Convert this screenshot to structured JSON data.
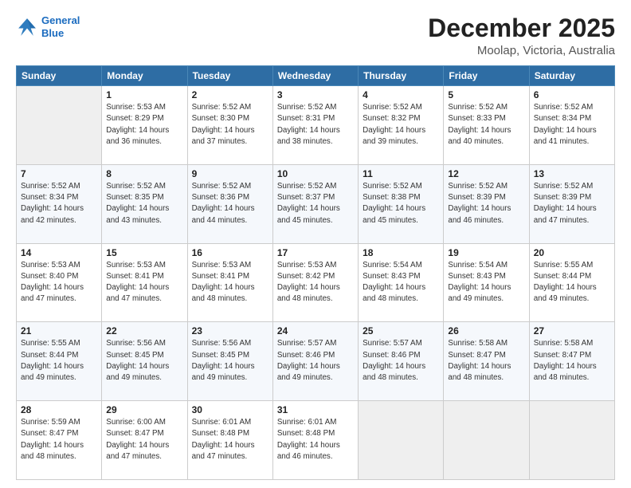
{
  "header": {
    "logo_line1": "General",
    "logo_line2": "Blue",
    "title": "December 2025",
    "subtitle": "Moolap, Victoria, Australia"
  },
  "calendar": {
    "days_of_week": [
      "Sunday",
      "Monday",
      "Tuesday",
      "Wednesday",
      "Thursday",
      "Friday",
      "Saturday"
    ],
    "weeks": [
      [
        {
          "day": "",
          "info": ""
        },
        {
          "day": "1",
          "info": "Sunrise: 5:53 AM\nSunset: 8:29 PM\nDaylight: 14 hours\nand 36 minutes."
        },
        {
          "day": "2",
          "info": "Sunrise: 5:52 AM\nSunset: 8:30 PM\nDaylight: 14 hours\nand 37 minutes."
        },
        {
          "day": "3",
          "info": "Sunrise: 5:52 AM\nSunset: 8:31 PM\nDaylight: 14 hours\nand 38 minutes."
        },
        {
          "day": "4",
          "info": "Sunrise: 5:52 AM\nSunset: 8:32 PM\nDaylight: 14 hours\nand 39 minutes."
        },
        {
          "day": "5",
          "info": "Sunrise: 5:52 AM\nSunset: 8:33 PM\nDaylight: 14 hours\nand 40 minutes."
        },
        {
          "day": "6",
          "info": "Sunrise: 5:52 AM\nSunset: 8:34 PM\nDaylight: 14 hours\nand 41 minutes."
        }
      ],
      [
        {
          "day": "7",
          "info": "Sunrise: 5:52 AM\nSunset: 8:34 PM\nDaylight: 14 hours\nand 42 minutes."
        },
        {
          "day": "8",
          "info": "Sunrise: 5:52 AM\nSunset: 8:35 PM\nDaylight: 14 hours\nand 43 minutes."
        },
        {
          "day": "9",
          "info": "Sunrise: 5:52 AM\nSunset: 8:36 PM\nDaylight: 14 hours\nand 44 minutes."
        },
        {
          "day": "10",
          "info": "Sunrise: 5:52 AM\nSunset: 8:37 PM\nDaylight: 14 hours\nand 45 minutes."
        },
        {
          "day": "11",
          "info": "Sunrise: 5:52 AM\nSunset: 8:38 PM\nDaylight: 14 hours\nand 45 minutes."
        },
        {
          "day": "12",
          "info": "Sunrise: 5:52 AM\nSunset: 8:39 PM\nDaylight: 14 hours\nand 46 minutes."
        },
        {
          "day": "13",
          "info": "Sunrise: 5:52 AM\nSunset: 8:39 PM\nDaylight: 14 hours\nand 47 minutes."
        }
      ],
      [
        {
          "day": "14",
          "info": "Sunrise: 5:53 AM\nSunset: 8:40 PM\nDaylight: 14 hours\nand 47 minutes."
        },
        {
          "day": "15",
          "info": "Sunrise: 5:53 AM\nSunset: 8:41 PM\nDaylight: 14 hours\nand 47 minutes."
        },
        {
          "day": "16",
          "info": "Sunrise: 5:53 AM\nSunset: 8:41 PM\nDaylight: 14 hours\nand 48 minutes."
        },
        {
          "day": "17",
          "info": "Sunrise: 5:53 AM\nSunset: 8:42 PM\nDaylight: 14 hours\nand 48 minutes."
        },
        {
          "day": "18",
          "info": "Sunrise: 5:54 AM\nSunset: 8:43 PM\nDaylight: 14 hours\nand 48 minutes."
        },
        {
          "day": "19",
          "info": "Sunrise: 5:54 AM\nSunset: 8:43 PM\nDaylight: 14 hours\nand 49 minutes."
        },
        {
          "day": "20",
          "info": "Sunrise: 5:55 AM\nSunset: 8:44 PM\nDaylight: 14 hours\nand 49 minutes."
        }
      ],
      [
        {
          "day": "21",
          "info": "Sunrise: 5:55 AM\nSunset: 8:44 PM\nDaylight: 14 hours\nand 49 minutes."
        },
        {
          "day": "22",
          "info": "Sunrise: 5:56 AM\nSunset: 8:45 PM\nDaylight: 14 hours\nand 49 minutes."
        },
        {
          "day": "23",
          "info": "Sunrise: 5:56 AM\nSunset: 8:45 PM\nDaylight: 14 hours\nand 49 minutes."
        },
        {
          "day": "24",
          "info": "Sunrise: 5:57 AM\nSunset: 8:46 PM\nDaylight: 14 hours\nand 49 minutes."
        },
        {
          "day": "25",
          "info": "Sunrise: 5:57 AM\nSunset: 8:46 PM\nDaylight: 14 hours\nand 48 minutes."
        },
        {
          "day": "26",
          "info": "Sunrise: 5:58 AM\nSunset: 8:47 PM\nDaylight: 14 hours\nand 48 minutes."
        },
        {
          "day": "27",
          "info": "Sunrise: 5:58 AM\nSunset: 8:47 PM\nDaylight: 14 hours\nand 48 minutes."
        }
      ],
      [
        {
          "day": "28",
          "info": "Sunrise: 5:59 AM\nSunset: 8:47 PM\nDaylight: 14 hours\nand 48 minutes."
        },
        {
          "day": "29",
          "info": "Sunrise: 6:00 AM\nSunset: 8:47 PM\nDaylight: 14 hours\nand 47 minutes."
        },
        {
          "day": "30",
          "info": "Sunrise: 6:01 AM\nSunset: 8:48 PM\nDaylight: 14 hours\nand 47 minutes."
        },
        {
          "day": "31",
          "info": "Sunrise: 6:01 AM\nSunset: 8:48 PM\nDaylight: 14 hours\nand 46 minutes."
        },
        {
          "day": "",
          "info": ""
        },
        {
          "day": "",
          "info": ""
        },
        {
          "day": "",
          "info": ""
        }
      ]
    ]
  }
}
